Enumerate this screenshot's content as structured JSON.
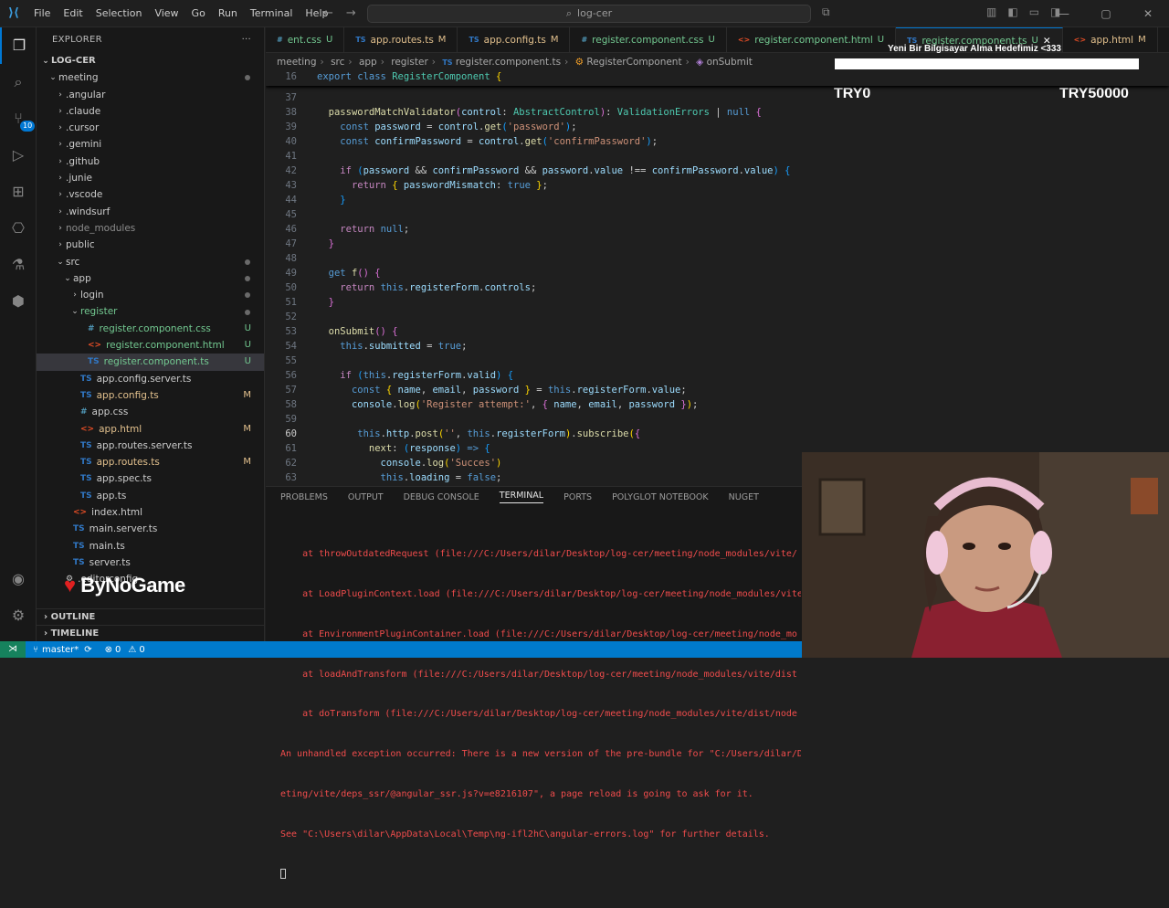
{
  "titlebar": {
    "menu": [
      "File",
      "Edit",
      "Selection",
      "View",
      "Go",
      "Run",
      "Terminal",
      "Help"
    ],
    "search": "log-cer"
  },
  "explorer": {
    "header": "EXPLORER",
    "root": "LOG-CER",
    "items": [
      {
        "label": "meeting",
        "indent": 1,
        "type": "folder-open",
        "status": "dot"
      },
      {
        "label": ".angular",
        "indent": 2,
        "type": "folder"
      },
      {
        "label": ".claude",
        "indent": 2,
        "type": "folder"
      },
      {
        "label": ".cursor",
        "indent": 2,
        "type": "folder"
      },
      {
        "label": ".gemini",
        "indent": 2,
        "type": "folder"
      },
      {
        "label": ".github",
        "indent": 2,
        "type": "folder"
      },
      {
        "label": ".junie",
        "indent": 2,
        "type": "folder"
      },
      {
        "label": ".vscode",
        "indent": 2,
        "type": "folder"
      },
      {
        "label": ".windsurf",
        "indent": 2,
        "type": "folder"
      },
      {
        "label": "node_modules",
        "indent": 2,
        "type": "folder",
        "dim": true
      },
      {
        "label": "public",
        "indent": 2,
        "type": "folder"
      },
      {
        "label": "src",
        "indent": 2,
        "type": "folder-open",
        "status": "dot"
      },
      {
        "label": "app",
        "indent": 3,
        "type": "folder-open",
        "status": "dot"
      },
      {
        "label": "login",
        "indent": 4,
        "type": "folder",
        "status": "dot"
      },
      {
        "label": "register",
        "indent": 4,
        "type": "folder-open",
        "status": "dot",
        "color": "unt"
      },
      {
        "label": "register.component.css",
        "indent": 5,
        "type": "css",
        "status": "U"
      },
      {
        "label": "register.component.html",
        "indent": 5,
        "type": "html",
        "status": "U"
      },
      {
        "label": "register.component.ts",
        "indent": 5,
        "type": "ts",
        "status": "U",
        "selected": true
      },
      {
        "label": "app.config.server.ts",
        "indent": 4,
        "type": "ts"
      },
      {
        "label": "app.config.ts",
        "indent": 4,
        "type": "ts",
        "status": "M"
      },
      {
        "label": "app.css",
        "indent": 4,
        "type": "css"
      },
      {
        "label": "app.html",
        "indent": 4,
        "type": "html",
        "status": "M"
      },
      {
        "label": "app.routes.server.ts",
        "indent": 4,
        "type": "ts"
      },
      {
        "label": "app.routes.ts",
        "indent": 4,
        "type": "ts",
        "status": "M"
      },
      {
        "label": "app.spec.ts",
        "indent": 4,
        "type": "ts"
      },
      {
        "label": "app.ts",
        "indent": 4,
        "type": "ts"
      },
      {
        "label": "index.html",
        "indent": 3,
        "type": "html"
      },
      {
        "label": "main.server.ts",
        "indent": 3,
        "type": "ts"
      },
      {
        "label": "main.ts",
        "indent": 3,
        "type": "ts"
      },
      {
        "label": "server.ts",
        "indent": 3,
        "type": "ts"
      },
      {
        "label": ".editorconfig",
        "indent": 2,
        "type": "gear"
      }
    ],
    "outline": "OUTLINE",
    "timeline": "TIMELINE"
  },
  "tabs": [
    {
      "label": "ent.css",
      "icon": "#",
      "status": "U",
      "kind": "css"
    },
    {
      "label": "app.routes.ts",
      "icon": "TS",
      "status": "M",
      "kind": "ts"
    },
    {
      "label": "app.config.ts",
      "icon": "TS",
      "status": "M",
      "kind": "ts"
    },
    {
      "label": "register.component.css",
      "icon": "#",
      "status": "U",
      "kind": "css"
    },
    {
      "label": "register.component.html",
      "icon": "<>",
      "status": "U",
      "kind": "html"
    },
    {
      "label": "register.component.ts",
      "icon": "TS",
      "status": "U",
      "kind": "ts",
      "active": true
    },
    {
      "label": "app.html",
      "icon": "<>",
      "status": "M",
      "kind": "html"
    }
  ],
  "breadcrumb": [
    "meeting",
    "src",
    "app",
    "register",
    "register.component.ts",
    "RegisterComponent",
    "onSubmit"
  ],
  "editor": {
    "sticky_number": "16",
    "current_line": "60"
  },
  "panel": {
    "tabs": [
      "PROBLEMS",
      "OUTPUT",
      "DEBUG CONSOLE",
      "TERMINAL",
      "PORTS",
      "POLYGLOT NOTEBOOK",
      "NUGET"
    ],
    "active": "TERMINAL",
    "lines": [
      "    at throwOutdatedRequest (file:///C:/Users/dilar/Desktop/log-cer/meeting/node_modules/vite/",
      "    at LoadPluginContext.load (file:///C:/Users/dilar/Desktop/log-cer/meeting/node_modules/vite/",
      "    at EnvironmentPluginContainer.load (file:///C:/Users/dilar/Desktop/log-cer/meeting/node_mo",
      "    at loadAndTransform (file:///C:/Users/dilar/Desktop/log-cer/meeting/node_modules/vite/dist",
      "    at doTransform (file:///C:/Users/dilar/Desktop/log-cer/meeting/node_modules/vite/dist/node",
      "An unhandled exception occurred: There is a new version of the pre-bundle for \"C:/Users/dilar/De",
      "eting/vite/deps_ssr/@angular_ssr.js?v=e8216107\", a page reload is going to ask for it.",
      "See \"C:\\Users\\dilar\\AppData\\Local\\Temp\\ng-ifl2hC\\angular-errors.log\" for further details."
    ]
  },
  "statusbar": {
    "branch": "master*",
    "errors": "0",
    "warnings": "0"
  },
  "overlay": {
    "goal_title": "Yeni Bir Bilgisayar Alma Hedefimiz <333",
    "current": "TRY0",
    "target": "TRY50000",
    "logo": "ByNoGame"
  }
}
